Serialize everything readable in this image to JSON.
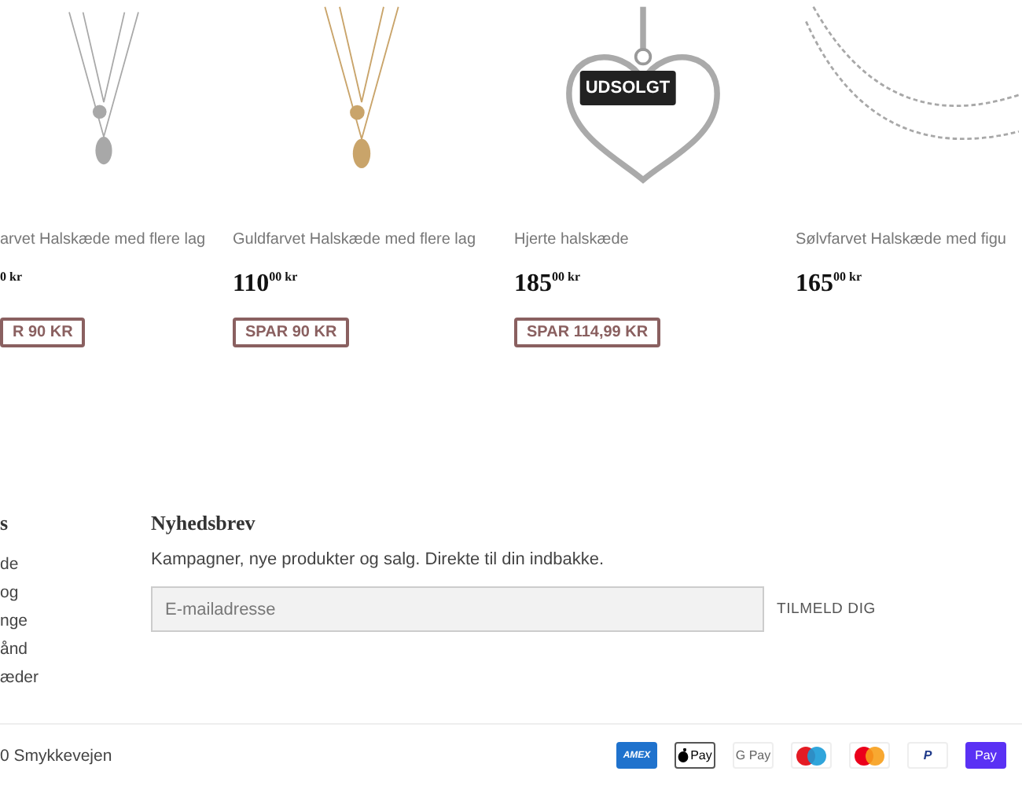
{
  "products": [
    {
      "kind": "silver-layered",
      "title": "arvet Halskæde med flere lag",
      "price": "$^{0 kr}$",
      "sold_out": false,
      "badge": "R 90 KR"
    },
    {
      "kind": "gold-layered",
      "title": "Guldfarvet Halskæde med flere lag",
      "price": "110$^{00 kr}$",
      "sold_out": false,
      "badge": "SPAR 90 KR"
    },
    {
      "kind": "heart",
      "title": "Hjerte halskæde",
      "price": "185$^{00 kr}$",
      "sold_out": true,
      "sold_out_label": "UDSOLGT",
      "badge": "SPAR 114,99 KR"
    },
    {
      "kind": "silver-stars",
      "title": "Sølvfarvet Halskæde med figu",
      "price": "165$^{00 kr}$",
      "sold_out": false
    }
  ],
  "footer": {
    "links_heading": "s",
    "links": [
      "de",
      "og",
      "nge",
      "ånd",
      "æder"
    ],
    "newsletter": {
      "heading": "Nyhedsbrev",
      "text": "Kampagner, nye produkter og salg. Direkte til din indbakke.",
      "placeholder": "E-mailadresse",
      "button": "TILMELD DIG"
    },
    "copyright": "0 Smykkevejen",
    "payments": [
      {
        "kind": "amex",
        "label": "AMEX"
      },
      {
        "kind": "applepay",
        "label": "Pay"
      },
      {
        "kind": "gpay",
        "label": "G Pay"
      },
      {
        "kind": "maestro"
      },
      {
        "kind": "mastercard"
      },
      {
        "kind": "paypal",
        "label": "P"
      },
      {
        "kind": "shoppay",
        "label": "Pay"
      }
    ]
  }
}
